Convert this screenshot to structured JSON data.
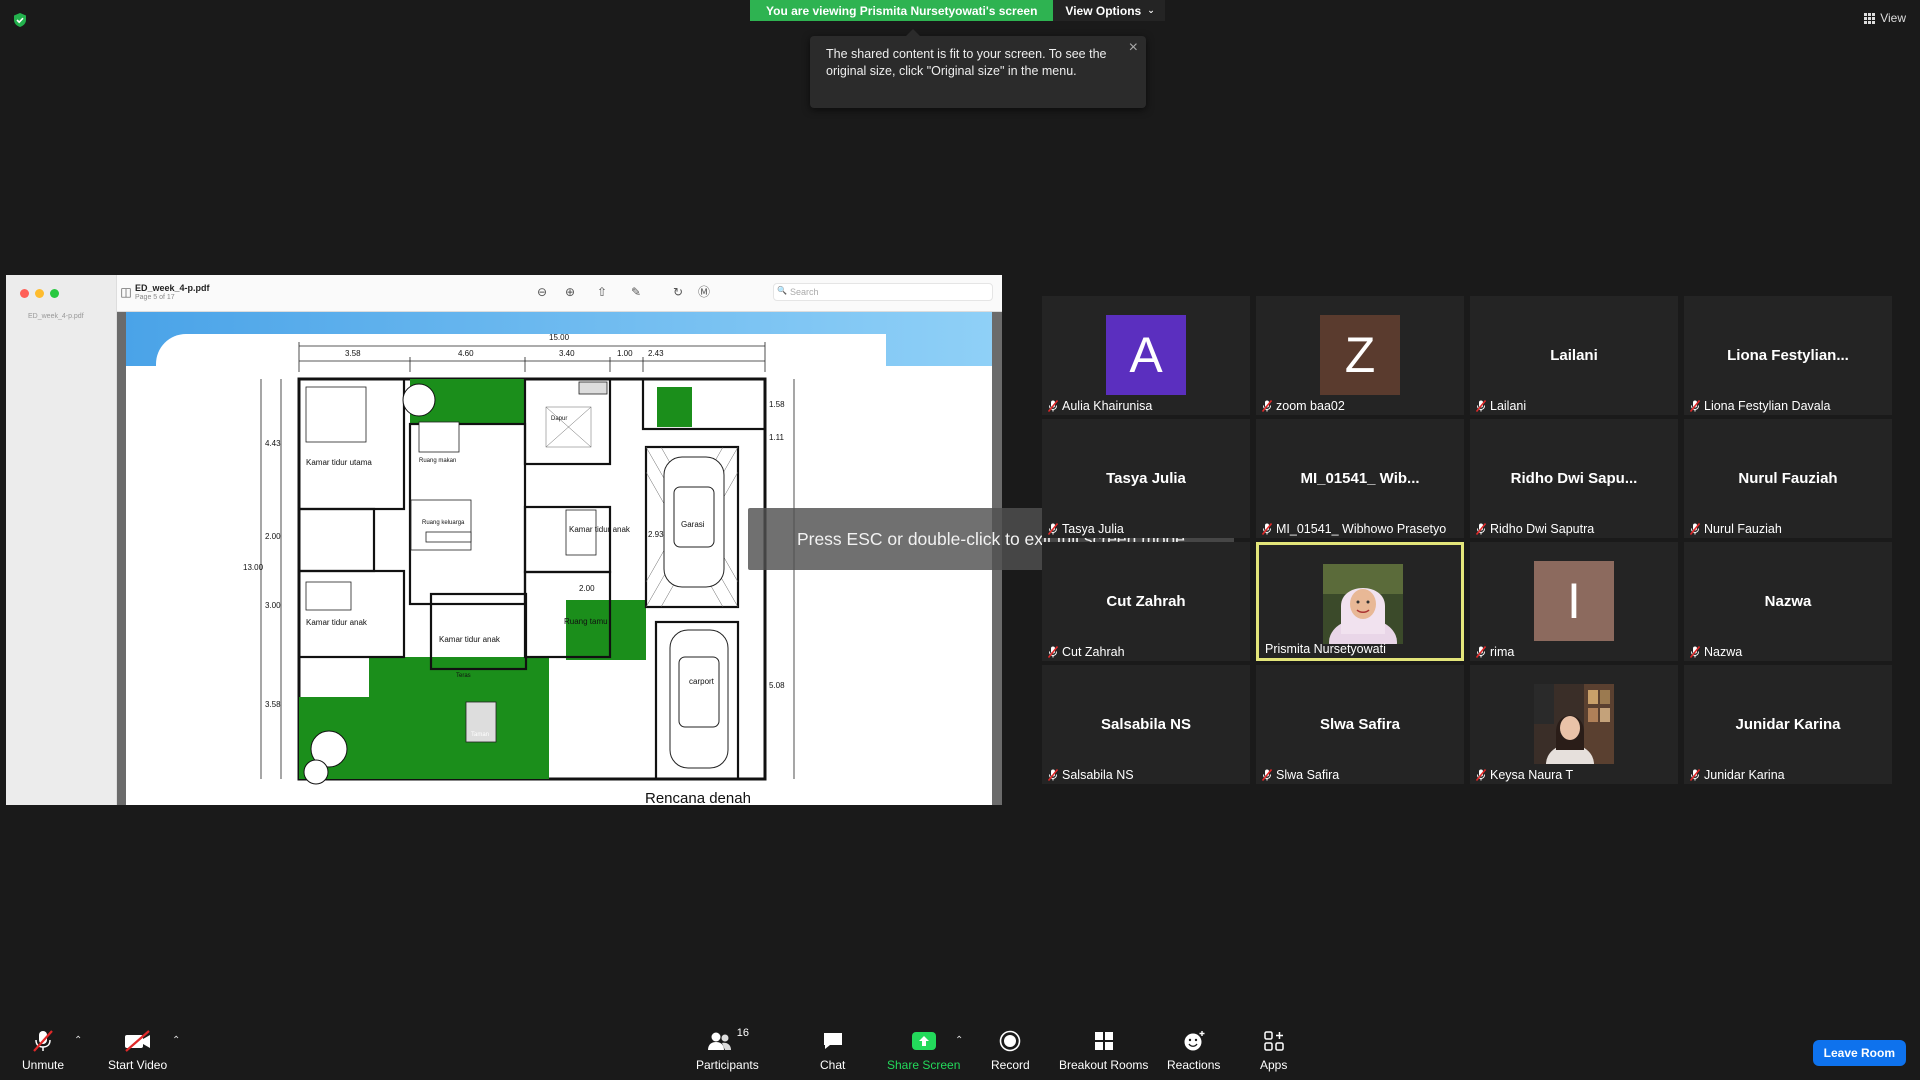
{
  "banner": {
    "viewing": "You are viewing Prismita Nursetyowati's screen",
    "view_options": "View Options"
  },
  "tooltip": {
    "text": "The shared content is fit to your screen. To see the original size, click \"Original size\" in the menu."
  },
  "view_button": "View",
  "pdf": {
    "sidebar_filename": "ED_week_4-p.pdf",
    "filename": "ED_week_4-p.pdf",
    "page_info": "Page 5 of 17",
    "search_placeholder": "Search",
    "caption": "Rencana denah",
    "dims_top": [
      "15.00",
      "3.58",
      "4.60",
      "3.40",
      "1.00",
      "2.43"
    ],
    "dims_left": [
      "4.43",
      "2.00",
      "13.00",
      "3.00",
      "3.58"
    ],
    "dims_right": [
      "1.58",
      "1.11",
      "5.08"
    ],
    "rooms": [
      "Kamar tidur utama",
      "Ruang makan",
      "Dapur",
      "Kamar tidur anak",
      "Ruang keluarga",
      "Garasi",
      "Kamar tidur anak",
      "Kamar tidur anak",
      "Ruang tamu",
      "carport",
      "Taman",
      "Teras",
      "2.00",
      "2.93"
    ]
  },
  "esc_notice": "Press ESC or double-click to exit full screen mode",
  "participants": [
    {
      "display": "A",
      "label": "Aulia Khairunisa",
      "avatar_color": "#5b2fbf",
      "muted": true
    },
    {
      "display": "Z",
      "label": "zoom baa02",
      "avatar_color": "#5a3b2e",
      "muted": true
    },
    {
      "display": "Lailani",
      "label": "Lailani",
      "muted": true
    },
    {
      "display": "Liona  Festylian...",
      "label": "Liona Festylian Davala",
      "muted": true
    },
    {
      "display": "Tasya Julia",
      "label": "Tasya Julia",
      "muted": true
    },
    {
      "display": "MI_01541_ Wib...",
      "label": "MI_01541_ Wibhowo Prasetyo",
      "muted": true
    },
    {
      "display": "Ridho  Dwi  Sapu...",
      "label": "Ridho Dwi Saputra",
      "muted": true
    },
    {
      "display": "Nurul Fauziah",
      "label": "Nurul Fauziah",
      "muted": true
    },
    {
      "display": "Cut Zahrah",
      "label": "Cut Zahrah",
      "muted": true
    },
    {
      "display": "",
      "label": "Prismita Nursetyowati",
      "muted": false,
      "active": true
    },
    {
      "display": "I",
      "label": "rima",
      "avatar_color": "#8c6a5e",
      "muted": true
    },
    {
      "display": "Nazwa",
      "label": "Nazwa",
      "muted": true
    },
    {
      "display": "Salsabila NS",
      "label": "Salsabila NS",
      "muted": true
    },
    {
      "display": "Slwa Safira",
      "label": "Slwa Safira",
      "muted": true
    },
    {
      "display": "",
      "label": "Keysa Naura T",
      "muted": true
    },
    {
      "display": "Junidar Karina",
      "label": "Junidar Karina",
      "muted": true
    }
  ],
  "toolbar": {
    "unmute": "Unmute",
    "start_video": "Start Video",
    "participants": "Participants",
    "participants_count": "16",
    "chat": "Chat",
    "share_screen": "Share Screen",
    "record": "Record",
    "breakout": "Breakout Rooms",
    "reactions": "Reactions",
    "apps": "Apps",
    "leave": "Leave Room"
  },
  "colors": {
    "share_green": "#23d95b",
    "leave_blue": "#0e72ed",
    "active_border": "#e3e57a",
    "banner_green": "#2eb351"
  }
}
